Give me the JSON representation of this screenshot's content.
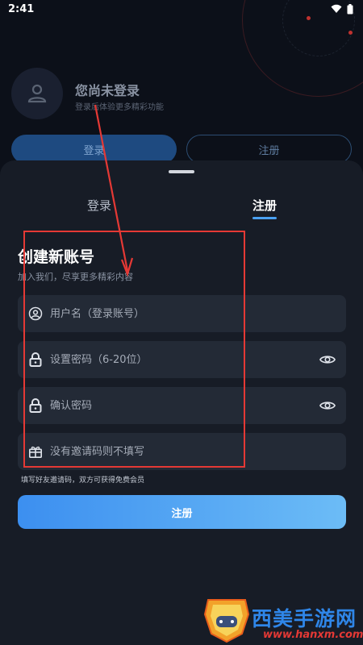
{
  "status_bar": {
    "time": "2:41"
  },
  "profile": {
    "title": "您尚未登录",
    "subtitle": "登录后体验更多精彩功能",
    "login_button": "登录",
    "register_button": "注册"
  },
  "sheet": {
    "tabs": [
      {
        "label": "登录",
        "active": false
      },
      {
        "label": "注册",
        "active": true
      }
    ],
    "form_title": "创建新账号",
    "form_subtitle": "加入我们，尽享更多精彩内容",
    "fields": {
      "username": {
        "placeholder": "用户名（登录账号）",
        "icon": "user-circle-icon"
      },
      "password": {
        "placeholder": "设置密码（6-20位）",
        "icon": "lock-icon"
      },
      "confirm": {
        "placeholder": "确认密码",
        "icon": "lock-icon"
      },
      "invite": {
        "placeholder": "没有邀请码则不填写",
        "icon": "gift-icon"
      }
    },
    "invite_hint": "填写好友邀请码，双方可获得免费会员",
    "submit_label": "注册"
  },
  "watermark": {
    "text": "西美手游网",
    "url": "www.hanxm.com"
  },
  "colors": {
    "accent": "#4aa1f2",
    "annotation": "#e53935",
    "sheet_bg": "#171c26"
  }
}
